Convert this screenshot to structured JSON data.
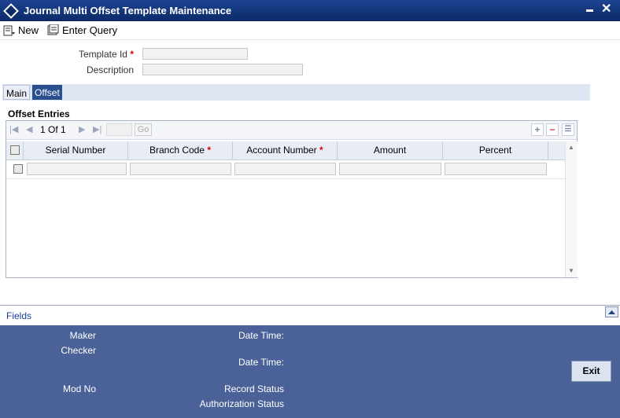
{
  "window": {
    "title": "Journal Multi Offset Template Maintenance"
  },
  "toolbar": {
    "new_label": "New",
    "enter_query_label": "Enter Query"
  },
  "form": {
    "template_id_label": "Template Id",
    "description_label": "Description",
    "required_mark": "*",
    "template_id_value": "",
    "description_value": ""
  },
  "tabs": [
    {
      "label": "Main"
    },
    {
      "label": "Offset"
    }
  ],
  "offset": {
    "section_title": "Offset Entries",
    "page_current": "1",
    "page_of": "Of",
    "page_total": "1",
    "go_label": "Go",
    "columns": [
      {
        "label": "Serial Number",
        "required": false
      },
      {
        "label": "Branch Code",
        "required": true
      },
      {
        "label": "Account Number",
        "required": true
      },
      {
        "label": "Amount",
        "required": false
      },
      {
        "label": "Percent",
        "required": false
      }
    ]
  },
  "fields_link": "Fields",
  "footer": {
    "maker": "Maker",
    "checker": "Checker",
    "date_time_1": "Date Time:",
    "date_time_2": "Date Time:",
    "mod_no": "Mod No",
    "record_status": "Record Status",
    "authorization_status": "Authorization Status",
    "exit_label": "Exit"
  }
}
